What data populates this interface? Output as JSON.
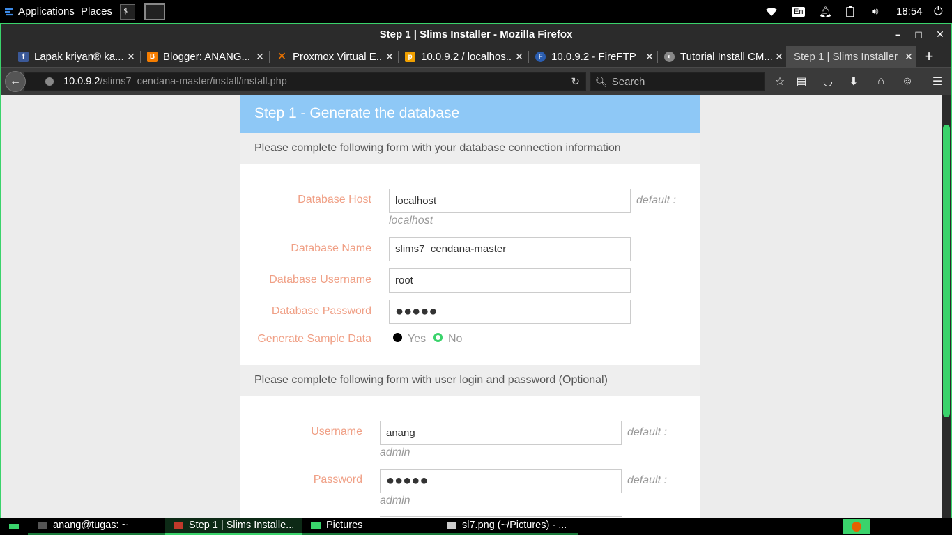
{
  "top_panel": {
    "applications_label": "Applications",
    "places_label": "Places",
    "terminal_icon_text": "$_",
    "keyboard_layout": "En",
    "clock": "18:54"
  },
  "window": {
    "title": "Step 1 | Slims Installer - Mozilla Firefox",
    "controls": {
      "minimize": "–",
      "maximize": "◻",
      "close": "✕"
    }
  },
  "tabs": [
    {
      "label": "Lapak kriyan® ka...",
      "icon": "facebook-icon",
      "color": "#3b5998",
      "glyph": "f"
    },
    {
      "label": "Blogger: ANANG...",
      "icon": "blogger-icon",
      "color": "#f57d00",
      "glyph": "B"
    },
    {
      "label": "Proxmox Virtual E...",
      "icon": "proxmox-icon",
      "color": "#e57000",
      "glyph": "✕"
    },
    {
      "label": "10.0.9.2 / localhos...",
      "icon": "phpmyadmin-icon",
      "color": "#f0a000",
      "glyph": "p"
    },
    {
      "label": "10.0.9.2 - FireFTP",
      "icon": "fireftp-icon",
      "color": "#2a5db0",
      "glyph": "F"
    },
    {
      "label": "Tutorial Install CM...",
      "icon": "tutorial-icon",
      "color": "#888888",
      "glyph": "◐"
    },
    {
      "label": "Step 1 | Slims Installer",
      "icon": "",
      "color": "",
      "glyph": ""
    }
  ],
  "navbar": {
    "url_host": "10.0.9.2",
    "url_path": "/slims7_cendana-master/install/install.php",
    "search_placeholder": "Search"
  },
  "page": {
    "header": "Step 1 - Generate the database",
    "db_note": "Please complete following form with your database connection information",
    "db_fields": {
      "host_label": "Database Host",
      "host_value": "localhost",
      "host_hint_prefix": "default :",
      "host_hint_value": "localhost",
      "name_label": "Database Name",
      "name_value": "slims7_cendana-master",
      "user_label": "Database Username",
      "user_value": "root",
      "pass_label": "Database Password",
      "pass_value": "●●●●●",
      "sample_label": "Generate Sample Data",
      "sample_yes": "Yes",
      "sample_no": "No",
      "sample_selected": "Yes"
    },
    "login_note": "Please complete following form with user login and password (Optional)",
    "login_fields": {
      "username_label": "Username",
      "username_value": "anang",
      "username_hint_prefix": "default :",
      "username_hint_value": "admin",
      "password_label": "Password",
      "password_value": "●●●●●",
      "password_hint_prefix": "default :",
      "password_hint_value": "admin"
    }
  },
  "taskbar": [
    {
      "label": "anang@tugas: ~"
    },
    {
      "label": "Step 1 | Slims Installe..."
    },
    {
      "label": "Pictures"
    },
    {
      "label": "sl7.png (~/Pictures) - ..."
    }
  ],
  "colors": {
    "accent_green": "#3ad36b",
    "header_blue": "#8ec8f6",
    "label_salmon": "#f0a086"
  }
}
